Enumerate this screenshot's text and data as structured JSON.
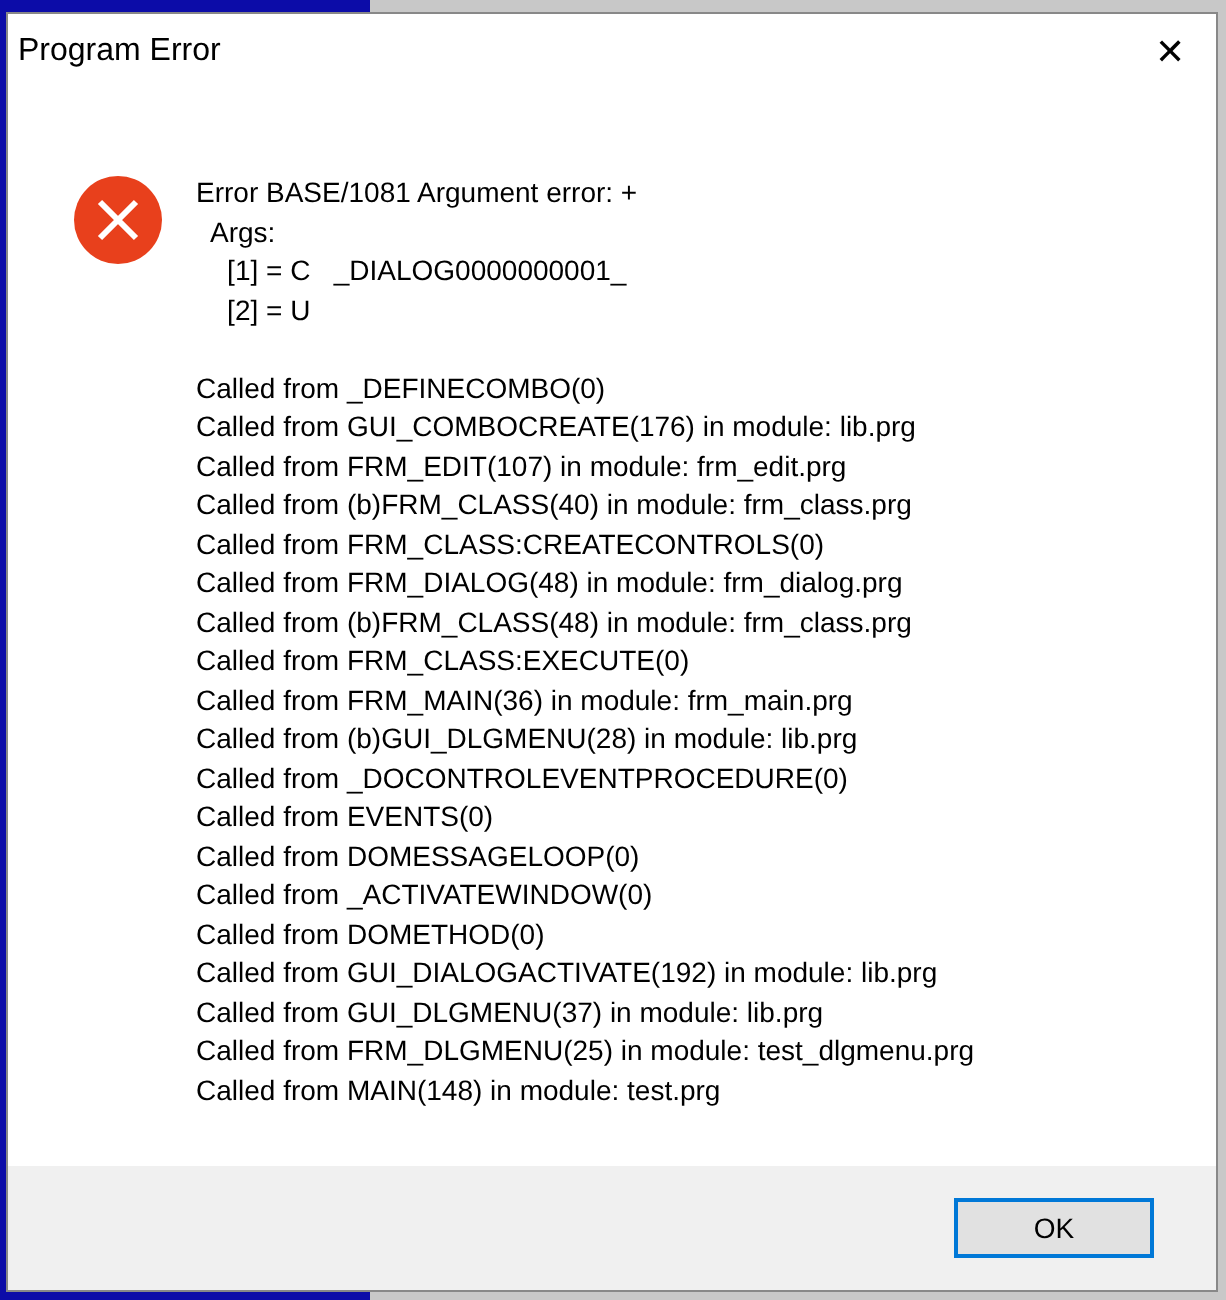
{
  "window": {
    "title": "Program Error",
    "close": "✕"
  },
  "message": {
    "header": [
      "Error BASE/1081 Argument error: +",
      "  Args:",
      "    [1] = C   _DIALOG0000000001_",
      "    [2] = U"
    ],
    "trace": [
      "Called from _DEFINECOMBO(0)",
      "Called from GUI_COMBOCREATE(176) in module: lib.prg",
      "Called from FRM_EDIT(107) in module: frm_edit.prg",
      "Called from (b)FRM_CLASS(40) in module: frm_class.prg",
      "Called from FRM_CLASS:CREATECONTROLS(0)",
      "Called from FRM_DIALOG(48) in module: frm_dialog.prg",
      "Called from (b)FRM_CLASS(48) in module: frm_class.prg",
      "Called from FRM_CLASS:EXECUTE(0)",
      "Called from FRM_MAIN(36) in module: frm_main.prg",
      "Called from (b)GUI_DLGMENU(28) in module: lib.prg",
      "Called from _DOCONTROLEVENTPROCEDURE(0)",
      "Called from EVENTS(0)",
      "Called from DOMESSAGELOOP(0)",
      "Called from _ACTIVATEWINDOW(0)",
      "Called from DOMETHOD(0)",
      "Called from GUI_DIALOGACTIVATE(192) in module: lib.prg",
      "Called from GUI_DLGMENU(37) in module: lib.prg",
      "Called from FRM_DLGMENU(25) in module: test_dlgmenu.prg",
      "Called from MAIN(148) in module: test.prg"
    ]
  },
  "buttons": [
    {
      "label": "OK",
      "selected": true
    }
  ]
}
